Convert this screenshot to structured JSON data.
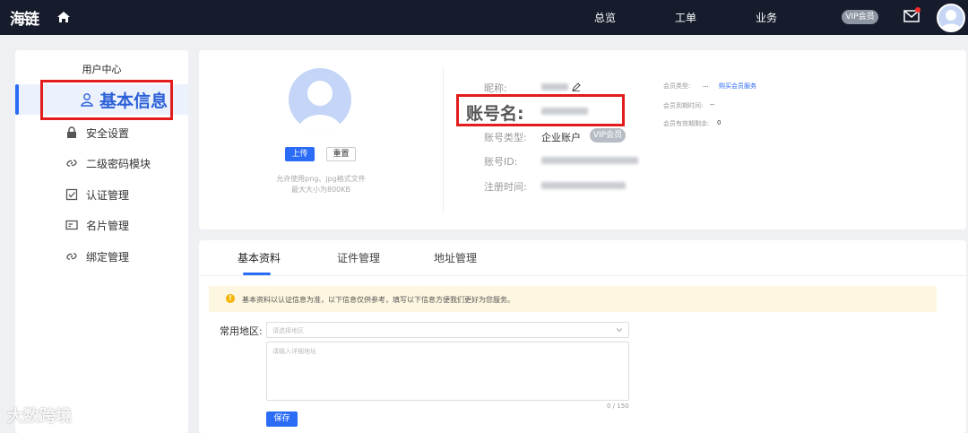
{
  "topbar": {
    "logo": "海链",
    "nav": [
      "总览",
      "工单",
      "业务"
    ],
    "vip_label": "VIP会员",
    "icons": [
      "home-icon",
      "mail-icon",
      "avatar"
    ]
  },
  "sidebar": {
    "title": "用户中心",
    "items": [
      {
        "label": "基本信息",
        "icon": "user-icon"
      },
      {
        "label": "安全设置",
        "icon": "lock-icon"
      },
      {
        "label": "二级密码模块",
        "icon": "link-icon"
      },
      {
        "label": "认证管理",
        "icon": "check-square-icon"
      },
      {
        "label": "名片管理",
        "icon": "card-icon"
      },
      {
        "label": "绑定管理",
        "icon": "link-icon"
      }
    ]
  },
  "profile": {
    "upload_label": "上传",
    "reset_label": "重置",
    "hint_line1": "允许使用png、jpg格式文件",
    "hint_line2": "最大大小为800KB",
    "nickname_label": "昵称:",
    "account_name_label": "账号名:",
    "account_type_label": "账号类型:",
    "account_type_value": "企业账户",
    "vip_tag": "VIP会员",
    "account_id_label": "账号ID:",
    "register_time_label": "注册时间:",
    "member_type_label": "会员类型:",
    "member_type_value": "...",
    "buy_member_link": "购买会员服务",
    "member_expire_label": "会员到期时间:",
    "member_expire_value": "--",
    "member_days_label": "会员有效期剩余:",
    "member_days_value": "0"
  },
  "main": {
    "tabs": [
      "基本资料",
      "证件管理",
      "地址管理"
    ],
    "active_tab": 0,
    "notice": "基本资料以认证信息为准，以下信息仅供参考，填写以下信息方便我们更好为您服务。",
    "region_label": "常用地区:",
    "region_placeholder": "请选择地区",
    "address_placeholder": "请输入详细地址",
    "counter": "0 / 150",
    "save_label": "保存"
  },
  "watermark": "大数跨境",
  "colors": {
    "accent": "#2b6cf6",
    "topbar": "#161c2c",
    "highlight": "#e11d1d"
  }
}
